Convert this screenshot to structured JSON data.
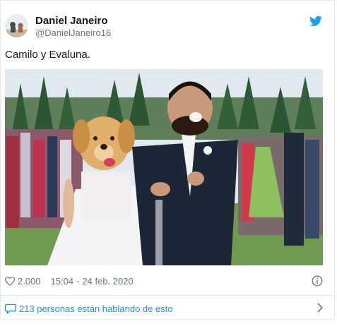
{
  "user": {
    "name": "Daniel Janeiro",
    "handle": "@DanielJaneiro16"
  },
  "tweet": {
    "text": "Camilo y Evaluna."
  },
  "meta": {
    "likes": "2.000",
    "time": "15:04",
    "separator": "-",
    "date": "24 feb. 2020"
  },
  "conversation": {
    "text": "213 personas están hablando de esto"
  },
  "colors": {
    "twitter_blue": "#1da1f2",
    "link_blue": "#1b95e0",
    "muted_text": "#657786",
    "border": "#e1e8ed"
  },
  "icons": {
    "brand": "twitter-bird-icon",
    "like": "heart-icon",
    "info": "info-icon",
    "conversation": "speech-bubble-icon",
    "more": "chevron-right-icon"
  }
}
